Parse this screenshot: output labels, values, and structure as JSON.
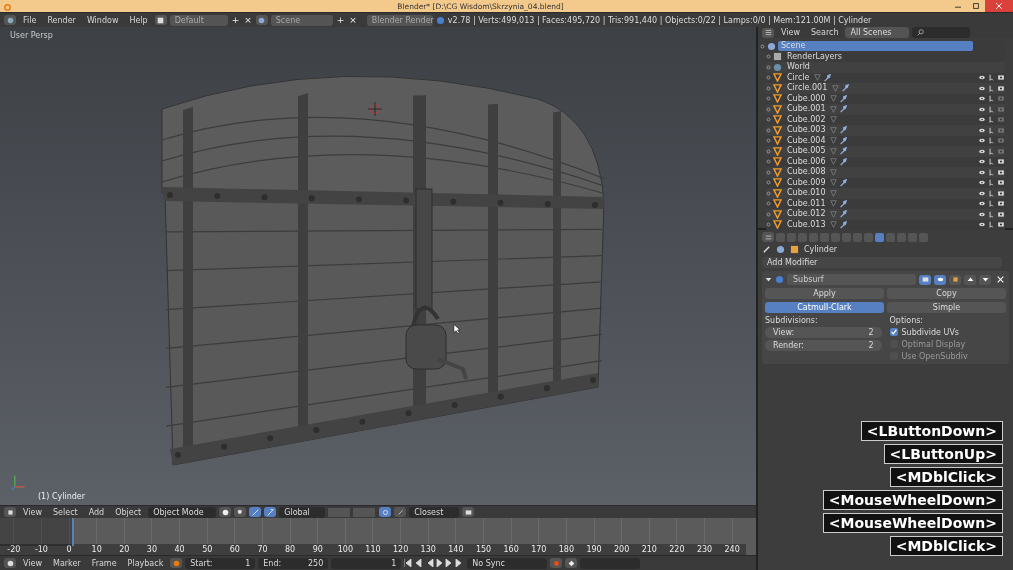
{
  "title_bar": {
    "title": "Blender* [D:\\CG Wisdom\\Skrzynia_04.blend]"
  },
  "info_header": {
    "menus": [
      "File",
      "Render",
      "Window",
      "Help"
    ],
    "layout": "Default",
    "layout_actions": [
      "+",
      "×"
    ],
    "scene": "Scene",
    "scene_actions": [
      "+",
      "×"
    ],
    "engine": "Blender Render",
    "stats": "v2.78 | Verts:499,013 | Faces:495,720 | Tris:991,440 | Objects:0/22 | Lamps:0/0 | Mem:121.00M | Cylinder"
  },
  "viewport": {
    "view_label": "User Persp",
    "object_label": "(1) Cylinder"
  },
  "outliner": {
    "menus": [
      "View",
      "Search"
    ],
    "filter": "All Scenes",
    "items": [
      {
        "name": "Scene",
        "kind": "scene",
        "selected": true,
        "children": [
          {
            "name": "RenderLayers",
            "kind": "render_layers",
            "selected": false
          },
          {
            "name": "World",
            "kind": "world",
            "selected": false
          },
          {
            "name": "Circle",
            "kind": "mesh",
            "selected": false,
            "modifier": true,
            "renderable": true
          },
          {
            "name": "Circle.001",
            "kind": "mesh",
            "selected": false,
            "modifier": true,
            "renderable": true
          },
          {
            "name": "Cube.000",
            "kind": "mesh",
            "selected": false,
            "modifier": true,
            "renderable": false
          },
          {
            "name": "Cube.001",
            "kind": "mesh",
            "selected": false,
            "modifier": true,
            "renderable": false
          },
          {
            "name": "Cube.002",
            "kind": "mesh",
            "selected": false,
            "modifier": false,
            "renderable": false
          },
          {
            "name": "Cube.003",
            "kind": "mesh",
            "selected": false,
            "modifier": true,
            "renderable": false
          },
          {
            "name": "Cube.004",
            "kind": "mesh",
            "selected": false,
            "modifier": true,
            "renderable": false
          },
          {
            "name": "Cube.005",
            "kind": "mesh",
            "selected": false,
            "modifier": true,
            "renderable": false
          },
          {
            "name": "Cube.006",
            "kind": "mesh",
            "selected": false,
            "modifier": true,
            "renderable": true
          },
          {
            "name": "Cube.008",
            "kind": "mesh",
            "selected": false,
            "modifier": false,
            "renderable": true
          },
          {
            "name": "Cube.009",
            "kind": "mesh",
            "selected": false,
            "modifier": true,
            "renderable": true
          },
          {
            "name": "Cube.010",
            "kind": "mesh",
            "selected": false,
            "modifier": false,
            "renderable": true
          },
          {
            "name": "Cube.011",
            "kind": "mesh",
            "selected": false,
            "modifier": true,
            "renderable": true
          },
          {
            "name": "Cube.012",
            "kind": "mesh",
            "selected": false,
            "modifier": true,
            "renderable": true
          },
          {
            "name": "Cube.013",
            "kind": "mesh",
            "selected": false,
            "modifier": true,
            "renderable": true
          }
        ]
      }
    ]
  },
  "properties": {
    "tabs": [
      {
        "selected": false
      },
      {
        "selected": false
      },
      {
        "selected": false
      },
      {
        "selected": false
      },
      {
        "selected": false
      },
      {
        "selected": false
      },
      {
        "selected": false
      },
      {
        "selected": false
      },
      {
        "selected": false
      },
      {
        "selected": true
      },
      {
        "selected": false
      },
      {
        "selected": false
      },
      {
        "selected": false
      },
      {
        "selected": false
      }
    ],
    "object": "Cylinder",
    "add_modifier": "Add Modifier",
    "modifier": {
      "name": "Subsurf",
      "apply": "Apply",
      "copy": "Copy",
      "modes": [
        {
          "label": "Catmull-Clark",
          "selected": true
        },
        {
          "label": "Simple",
          "selected": false
        }
      ],
      "subdivisions_label": "Subdivisions:",
      "fields": [
        {
          "label": "View:",
          "value": "2"
        },
        {
          "label": "Render:",
          "value": "2"
        }
      ],
      "options_label": "Options:",
      "options": [
        {
          "label": "Subdivide UVs",
          "checked": true
        },
        {
          "label": "Optimal Display",
          "checked": false
        },
        {
          "label": "Use OpenSubdiv",
          "checked": false
        }
      ]
    }
  },
  "key_overlay": [
    "<LButtonDown>",
    "<LButtonUp>",
    "<MDblClick>",
    "<MouseWheelDown>",
    "<MouseWheelDown>",
    "<MDblClick>"
  ],
  "view3d_header": {
    "menus": [
      "View",
      "Select",
      "Add",
      "Object"
    ],
    "mode": "Object Mode",
    "orientation": "Global",
    "snap": "Closest"
  },
  "timeline": {
    "ticks": [
      "-20",
      "-10",
      "0",
      "10",
      "20",
      "30",
      "40",
      "50",
      "60",
      "70",
      "80",
      "90",
      "100",
      "110",
      "120",
      "130",
      "140",
      "150",
      "160",
      "170",
      "180",
      "190",
      "200",
      "210",
      "220",
      "230",
      "240"
    ]
  },
  "timeline_header": {
    "menus": [
      "View",
      "Marker",
      "Frame",
      "Playback"
    ],
    "start_label": "Start:",
    "start": "1",
    "end_label": "End:",
    "end": "250",
    "current": "1",
    "sync": "No Sync"
  }
}
